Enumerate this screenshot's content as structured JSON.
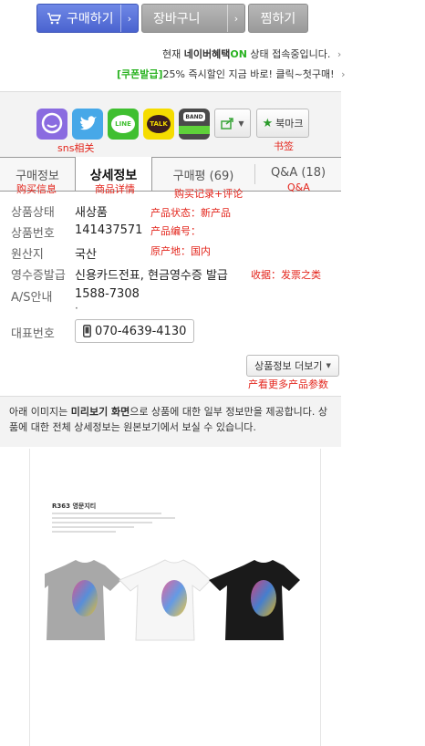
{
  "actions": {
    "buy": "구매하기",
    "cart": "장바구니",
    "wish": "찜하기"
  },
  "promo": {
    "line1_pre": "현재 ",
    "line1_brand": "네이버혜택",
    "line1_on": "ON",
    "line1_post": " 상태 접속중입니다.",
    "line2_tag": "[쿠폰발급]",
    "line2_text": "25% 즉시할인 지금 바로! 클릭~첫구매!"
  },
  "share": {
    "icons": [
      {
        "name": "chat-bubble-icon",
        "color": "#8a6be0"
      },
      {
        "name": "twitter-bird-icon",
        "color": "#47a8e8"
      },
      {
        "name": "line-icon",
        "color": "#3fbf30",
        "label": "LINE"
      },
      {
        "name": "kakaotalk-icon",
        "color": "#f5dc00",
        "label": "TALK"
      },
      {
        "name": "band-icon",
        "color": "#4a4a4a",
        "label": "BAND"
      }
    ],
    "bookmark_label": "북마크",
    "annot_sns": "sns相关",
    "annot_bookmark": "书签"
  },
  "tabs": [
    {
      "label": "구매정보",
      "annot": "购买信息"
    },
    {
      "label": "상세정보",
      "annot": "商品详情"
    },
    {
      "label": "구매평 (69)",
      "annot": "购买记录+评论"
    },
    {
      "label": "Q&A (18)",
      "annot": "Q&A"
    }
  ],
  "info": {
    "rows": [
      {
        "label": "상품상태",
        "value": "새상품",
        "annot": "产品状态：新产品"
      },
      {
        "label": "상품번호",
        "value": "141437571",
        "annot": "产品编号："
      },
      {
        "label": "원산지",
        "value": "국산",
        "annot": "原产地：国内"
      },
      {
        "label": "영수증발급",
        "value": "신용카드전표, 현금영수증 발급",
        "annot": "收据：发票之类"
      },
      {
        "label": "A/S안내",
        "value": "1588-7308",
        "annot": ""
      }
    ],
    "phone_label": "대표번호",
    "phone": "070-4639-4130"
  },
  "more": {
    "label": "상품정보 더보기",
    "annot": "产看更多产品参数"
  },
  "notice": {
    "pre": "아래 이미지는 ",
    "bold": "미리보기 화면",
    "post": "으로 상품에 대한 일부 정보만을 제공합니다. 상품에 대한 전체 상세정보는 원본보기에서 보실 수 있습니다."
  },
  "preview": {
    "title": "R363 영문지티",
    "tshirts": [
      {
        "color": "#a8a8a8"
      },
      {
        "color": "#f4f4f4"
      },
      {
        "color": "#1a1a1a"
      }
    ]
  }
}
